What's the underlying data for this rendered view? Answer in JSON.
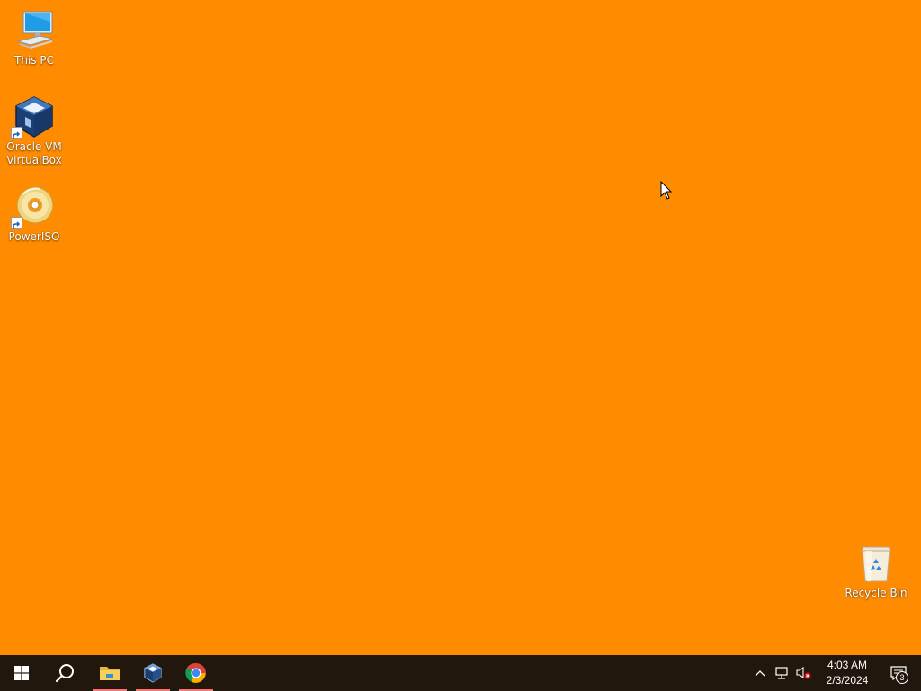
{
  "desktop": {
    "background_color": "#FF8C00",
    "icons": [
      {
        "label": "This PC",
        "icon": "this-pc-icon"
      },
      {
        "label": "Oracle VM VirtualBox",
        "icon": "virtualbox-icon",
        "shortcut": true
      },
      {
        "label": "PowerISO",
        "icon": "poweriso-icon",
        "shortcut": true
      },
      {
        "label": "Recycle Bin",
        "icon": "recycle-bin-icon"
      }
    ]
  },
  "taskbar": {
    "background_color": "#21170C",
    "buttons": [
      {
        "name": "start",
        "icon": "windows-logo-icon",
        "running": false
      },
      {
        "name": "search",
        "icon": "search-icon",
        "running": false
      },
      {
        "name": "file-explorer",
        "icon": "folder-icon",
        "running": true
      },
      {
        "name": "virtualbox",
        "icon": "virtualbox-icon",
        "running": true
      },
      {
        "name": "chrome",
        "icon": "chrome-icon",
        "running": true
      }
    ],
    "tray": {
      "icons": [
        "chevron-up-icon",
        "network-icon",
        "volume-muted-icon"
      ],
      "time": "4:03 AM",
      "date": "2/3/2024",
      "notification_count": "3"
    }
  }
}
